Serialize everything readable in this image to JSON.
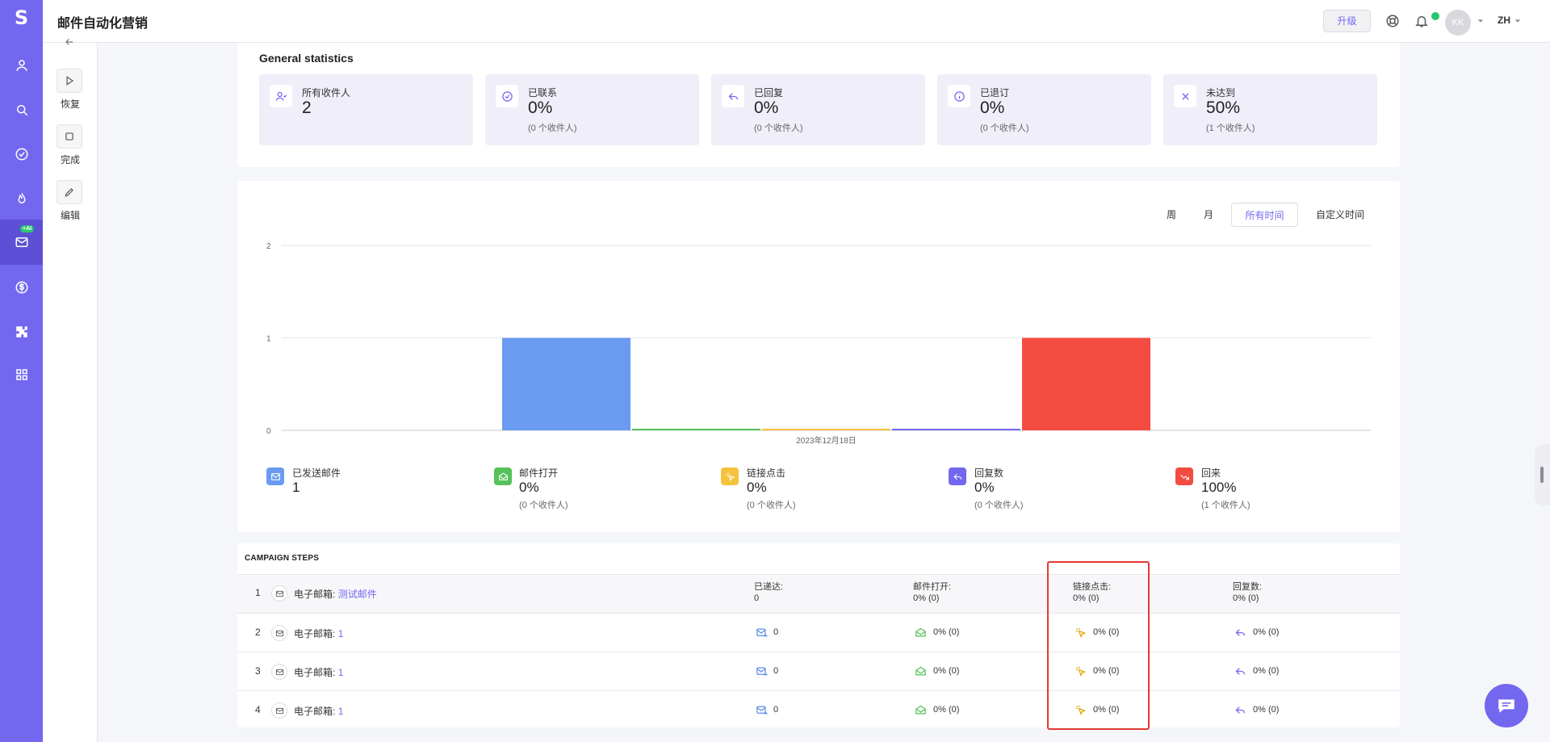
{
  "app": {
    "title": "邮件自动化营销",
    "logo": "S"
  },
  "nav": {
    "icons": [
      "user-icon",
      "search-icon",
      "check-circle-icon",
      "flame-icon",
      "mail-icon",
      "dollar-icon",
      "puzzle-icon",
      "grid-icon"
    ],
    "ai_badge": "+AI"
  },
  "header": {
    "upgrade": "升级",
    "avatar": "KK",
    "lang": "ZH"
  },
  "toolbar": {
    "resume": "恢复",
    "complete": "完成",
    "edit": "编辑"
  },
  "general": {
    "title": "General statistics",
    "stats": [
      {
        "label": "所有收件人",
        "value": "2",
        "sub": "",
        "icon": "users-icon"
      },
      {
        "label": "已联系",
        "value": "0%",
        "sub": "(0 个收件人)",
        "icon": "check-circle-icon"
      },
      {
        "label": "已回复",
        "value": "0%",
        "sub": "(0 个收件人)",
        "icon": "reply-icon"
      },
      {
        "label": "已退订",
        "value": "0%",
        "sub": "(0 个收件人)",
        "icon": "info-icon"
      },
      {
        "label": "未达到",
        "value": "50%",
        "sub": "(1 个收件人)",
        "icon": "x-icon"
      }
    ]
  },
  "range": {
    "week": "周",
    "month": "月",
    "all": "所有时间",
    "custom": "自定义时间"
  },
  "chart_data": {
    "type": "bar",
    "categories": [
      "2023年12月18日"
    ],
    "series": [
      {
        "name": "已发送邮件",
        "values": [
          1
        ],
        "color": "#6a9bf0"
      },
      {
        "name": "邮件打开",
        "values": [
          0
        ],
        "color": "#56c25b"
      },
      {
        "name": "链接点击",
        "values": [
          0
        ],
        "color": "#f4c23d"
      },
      {
        "name": "回复数",
        "values": [
          0
        ],
        "color": "#7367f0"
      },
      {
        "name": "回来",
        "values": [
          1
        ],
        "color": "#f44b40"
      }
    ],
    "ylim": [
      0,
      2
    ],
    "yticks": [
      "0",
      "1",
      "2"
    ],
    "xlabel": "",
    "ylabel": ""
  },
  "legend": [
    {
      "label": "已发送邮件",
      "value": "1",
      "sub": ""
    },
    {
      "label": "邮件打开",
      "value": "0%",
      "sub": "(0 个收件人)"
    },
    {
      "label": "链接点击",
      "value": "0%",
      "sub": "(0 个收件人)"
    },
    {
      "label": "回复数",
      "value": "0%",
      "sub": "(0 个收件人)"
    },
    {
      "label": "回来",
      "value": "100%",
      "sub": "(1 个收件人)"
    }
  ],
  "steps": {
    "title": "CAMPAIGN STEPS",
    "prefix": "电子邮箱:",
    "header_labels": {
      "delivered": "已递达:",
      "opened": "邮件打开:",
      "clicked": "链接点击:",
      "replies": "回复数:"
    },
    "rows": [
      {
        "num": "1",
        "name": "测试邮件",
        "delivered": "0",
        "opened": "0% (0)",
        "clicked": "0% (0)",
        "replies": "0% (0)"
      },
      {
        "num": "2",
        "name": "1",
        "delivered": "0",
        "opened": "0% (0)",
        "clicked": "0% (0)",
        "replies": "0% (0)"
      },
      {
        "num": "3",
        "name": "1",
        "delivered": "0",
        "opened": "0% (0)",
        "clicked": "0% (0)",
        "replies": "0% (0)"
      },
      {
        "num": "4",
        "name": "1",
        "delivered": "0",
        "opened": "0% (0)",
        "clicked": "0% (0)",
        "replies": "0% (0)"
      }
    ]
  }
}
